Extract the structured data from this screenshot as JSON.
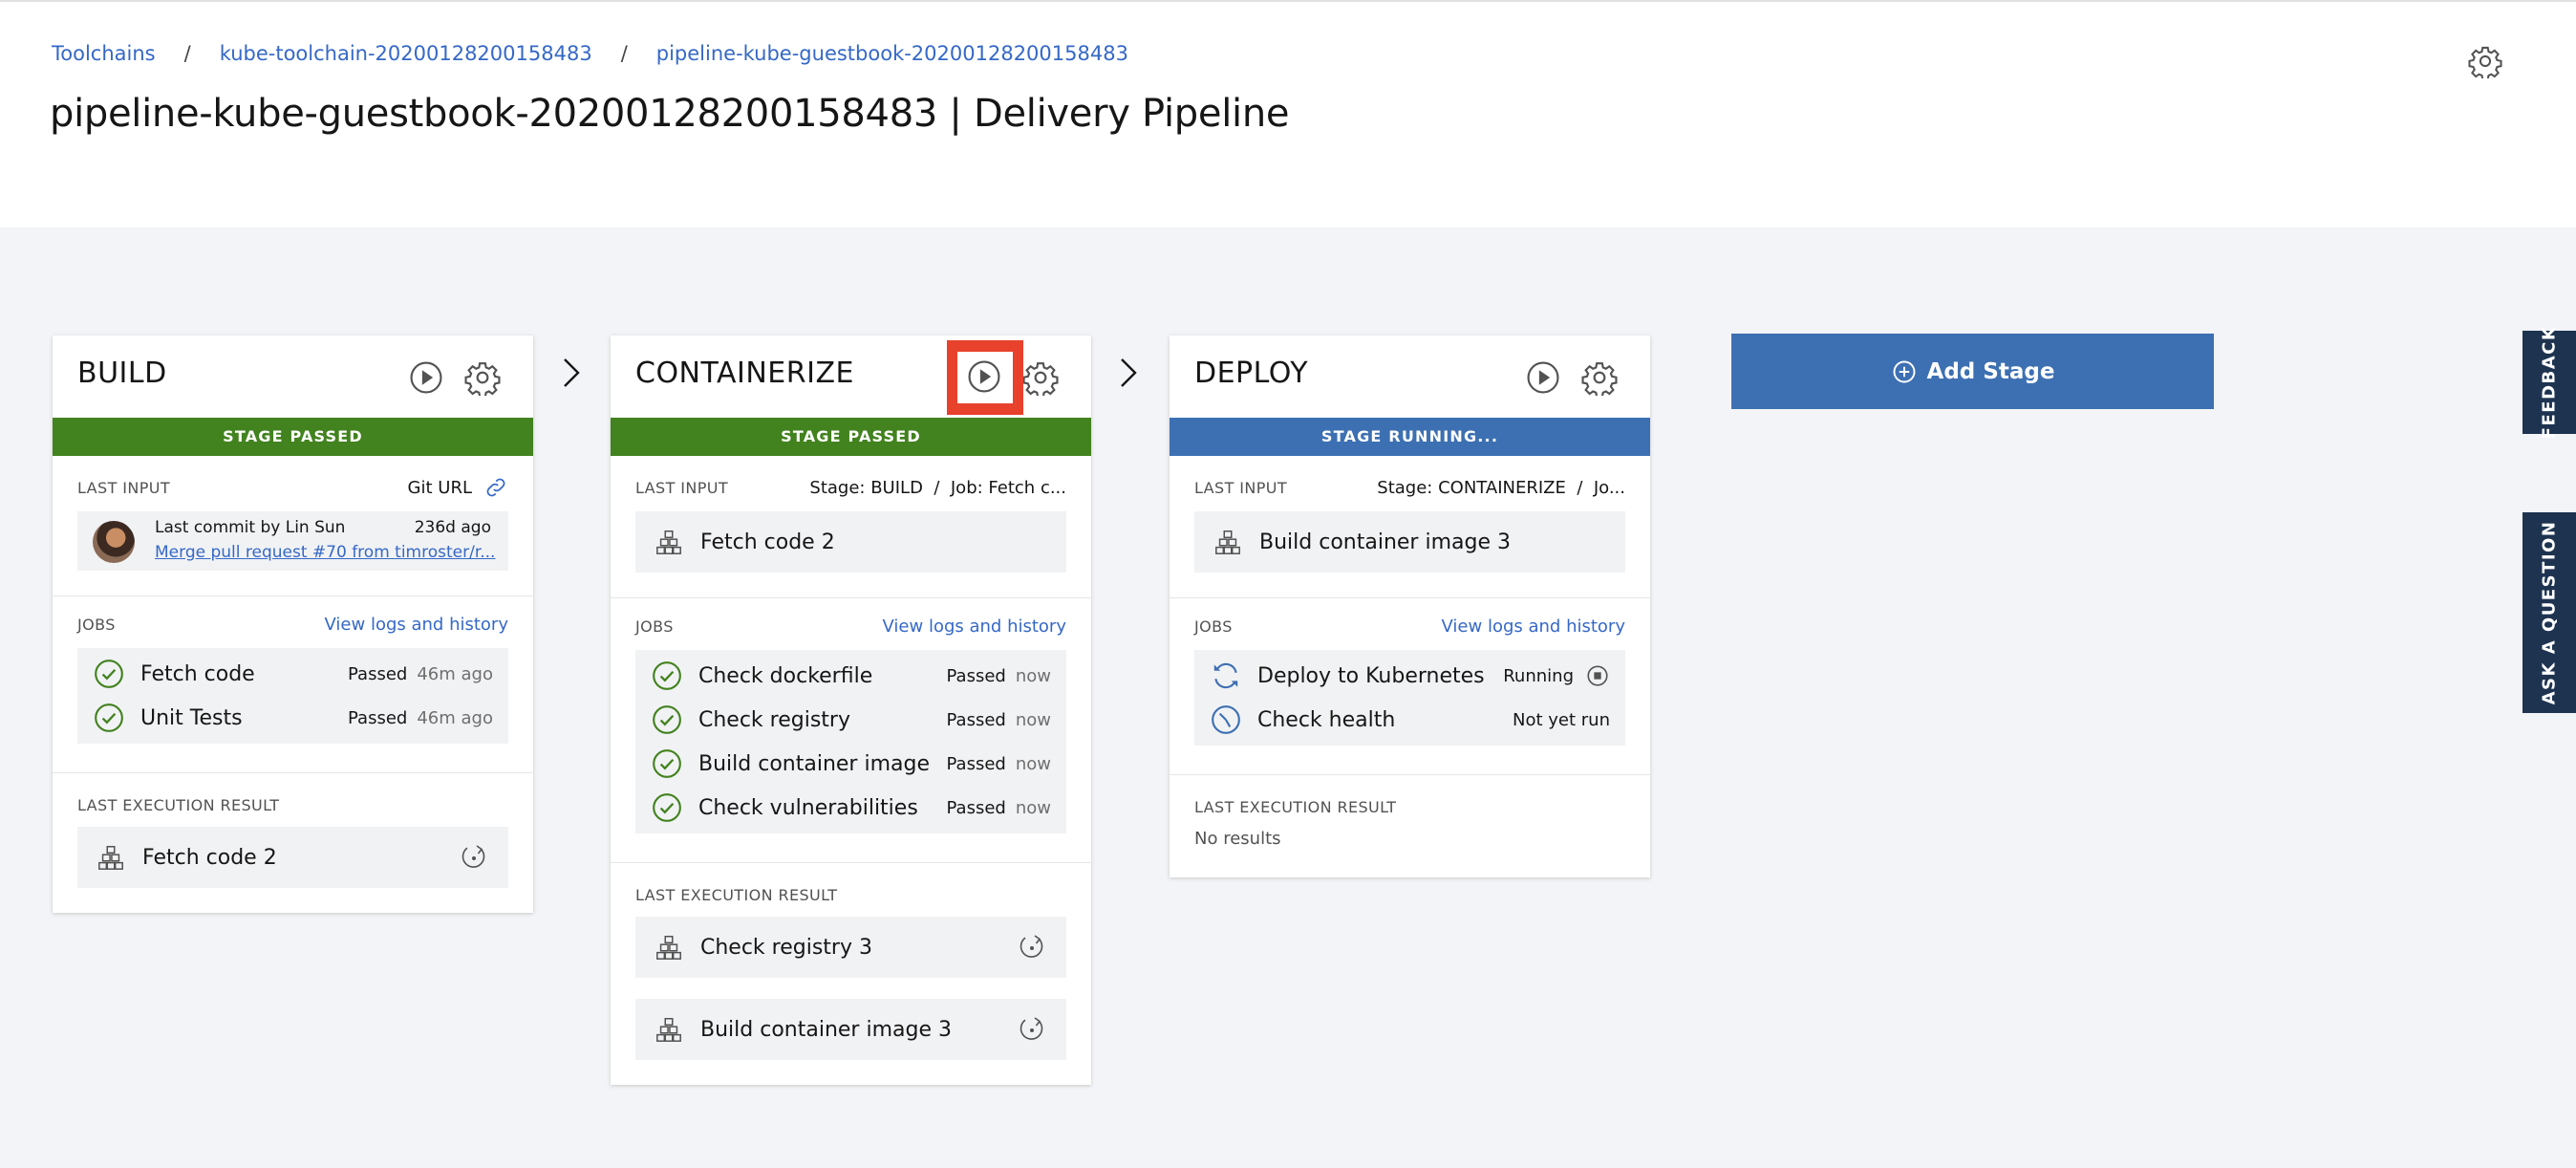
{
  "breadcrumb": [
    "Toolchains",
    "kube-toolchain-20200128200158483",
    "pipeline-kube-guestbook-20200128200158483"
  ],
  "breadcrumb_sep": "/",
  "page_title": "pipeline-kube-guestbook-20200128200158483 | Delivery Pipeline",
  "add_stage_label": "Add Stage",
  "side_tabs": {
    "feedback": "FEEDBACK",
    "ask": "ASK A QUESTION"
  },
  "colors": {
    "passed": "#42821f",
    "running": "#3d70b2",
    "accent": "#3568c7",
    "highlight": "#e8412c"
  },
  "stages": [
    {
      "title": "BUILD",
      "status": "STAGE PASSED",
      "last_input_label": "LAST INPUT",
      "input_source": "Git URL",
      "commit_author": "Last commit by Lin Sun",
      "commit_age": "236d ago",
      "commit_message": "Merge pull request #70 from timroster/r...",
      "jobs_label": "JOBS",
      "logs_link": "View logs and history",
      "jobs": [
        {
          "name": "Fetch code",
          "status": "Passed",
          "time": "46m ago",
          "icon": "check-circle-icon"
        },
        {
          "name": "Unit Tests",
          "status": "Passed",
          "time": "46m ago",
          "icon": "check-circle-icon"
        }
      ],
      "last_result_label": "LAST EXECUTION RESULT",
      "results": [
        "Fetch code 2"
      ]
    },
    {
      "title": "CONTAINERIZE",
      "status": "STAGE PASSED",
      "last_input_label": "LAST INPUT",
      "input_source": "Stage: BUILD  /  Job: Fetch c...",
      "input_value": "Fetch code 2",
      "jobs_label": "JOBS",
      "logs_link": "View logs and history",
      "jobs": [
        {
          "name": "Check dockerfile",
          "status": "Passed",
          "time": "now",
          "icon": "check-circle-icon"
        },
        {
          "name": "Check registry",
          "status": "Passed",
          "time": "now",
          "icon": "check-circle-icon"
        },
        {
          "name": "Build container image",
          "status": "Passed",
          "time": "now",
          "icon": "check-circle-icon"
        },
        {
          "name": "Check vulnerabilities",
          "status": "Passed",
          "time": "now",
          "icon": "check-circle-icon"
        }
      ],
      "last_result_label": "LAST EXECUTION RESULT",
      "results": [
        "Check registry 3",
        "Build container image 3"
      ]
    },
    {
      "title": "DEPLOY",
      "status": "STAGE RUNNING...",
      "last_input_label": "LAST INPUT",
      "input_source": "Stage: CONTAINERIZE  /  Jo...",
      "input_value": "Build container image 3",
      "jobs_label": "JOBS",
      "logs_link": "View logs and history",
      "jobs": [
        {
          "name": "Deploy to Kubernetes",
          "status": "Running",
          "time": "",
          "icon": "refresh-icon"
        },
        {
          "name": "Check health",
          "status": "Not yet run",
          "time": "",
          "icon": "clock-icon"
        }
      ],
      "last_result_label": "LAST EXECUTION RESULT",
      "no_results": "No results"
    }
  ]
}
